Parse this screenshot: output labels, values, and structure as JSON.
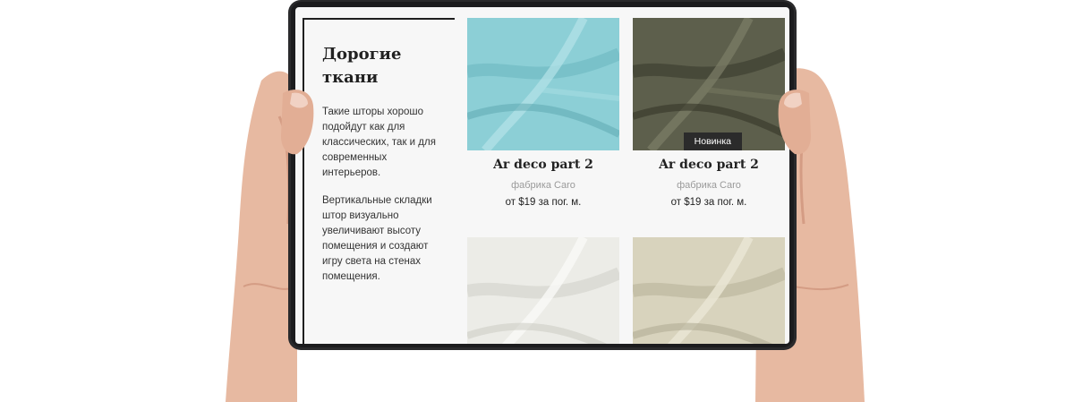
{
  "panel": {
    "title": "Дорогие ткани",
    "paragraph_1": "Такие шторы хорошо подойдут как для классических, так и для современных интерьеров.",
    "paragraph_2": "Вертикальные складки штор визуально увеличивают высоту помещения и создают игру света на стенах помещения."
  },
  "products": [
    {
      "name": "Ar deco part 2",
      "brand": "фабрика Caro",
      "price": "от $19 за пог. м.",
      "color": "#8ccfd6"
    },
    {
      "name": "Ar deco part 2",
      "brand": "фабрика Caro",
      "price": "от $19 за пог. м.",
      "color": "#5d5f4c",
      "badge": "Новинка"
    },
    {
      "color": "#ecece7"
    },
    {
      "color": "#d8d3bd"
    }
  ],
  "icons": {
    "left_hand": "hand-icon",
    "right_hand": "hand-icon"
  }
}
